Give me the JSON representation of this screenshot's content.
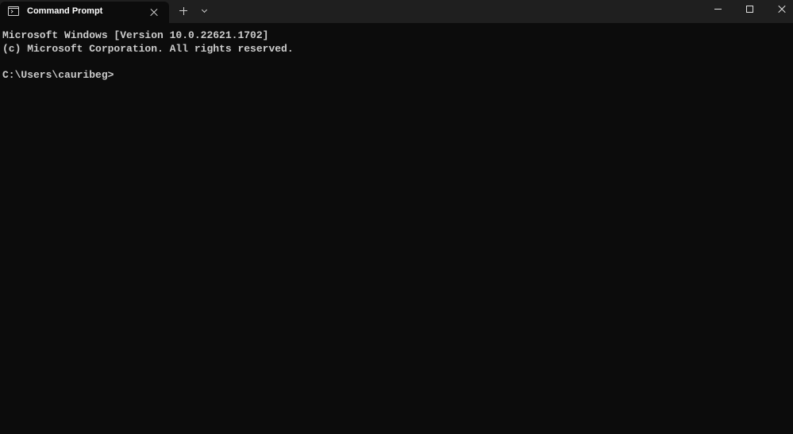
{
  "window": {
    "tab": {
      "icon": "terminal-icon",
      "title": "Command Prompt",
      "close_icon": "close-icon"
    },
    "new_tab_icon": "plus-icon",
    "dropdown_icon": "chevron-down-icon",
    "controls": {
      "minimize_icon": "minimize-icon",
      "maximize_icon": "maximize-icon",
      "close_icon": "close-icon"
    }
  },
  "terminal": {
    "lines": [
      "Microsoft Windows [Version 10.0.22621.1702]",
      "(c) Microsoft Corporation. All rights reserved.",
      "",
      "C:\\Users\\cauribeg>"
    ]
  },
  "colors": {
    "background": "#0c0c0c",
    "titlebar": "#1f1f1f",
    "text": "#cccccc"
  }
}
